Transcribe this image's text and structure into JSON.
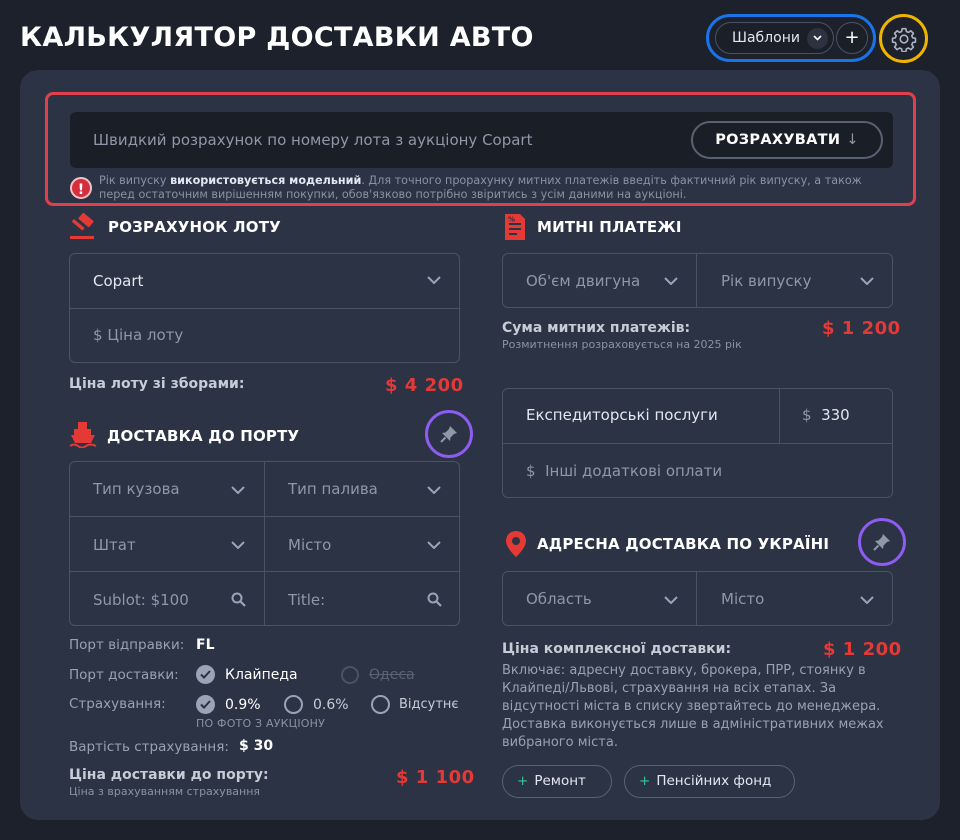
{
  "header": {
    "title": "КАЛЬКУЛЯТОР ДОСТАВКИ АВТО",
    "templates_label": "Шаблони",
    "add_label": "+"
  },
  "quick": {
    "placeholder": "Швидкий розрахунок по номеру лота з аукціону Copart",
    "button_label": "РОЗРАХУВАТИ",
    "button_arrow": "↓",
    "warning_prefix": "Рік випуску ",
    "warning_bold": "використовується модельний",
    "warning_line1_rest": ". Для точного прорахунку митних платежів введіть фактичний рік випуску, а також",
    "warning_line2": "перед остаточним вирішенням покупки, обов'язково потрібно звіритись з усім даними на аукціоні."
  },
  "lot": {
    "title": "РОЗРАХУНОК ЛОТУ",
    "auction_value": "Copart",
    "price_currency": "$",
    "price_placeholder": "Ціна лоту",
    "total_label": "Ціна лоту зі зборами:",
    "total_value": "$ 4 200"
  },
  "port": {
    "title": "ДОСТАВКА ДО ПОРТУ",
    "body_type": "Тип кузова",
    "fuel_type": "Тип палива",
    "state": "Штат",
    "city": "Місто",
    "sublot": "Sublot: $100",
    "title_field": "Title:",
    "departure_label": "Порт відправки:",
    "departure_value": "FL",
    "destination_label": "Порт доставки:",
    "destination_options": [
      "Клайпеда",
      "Одеса"
    ],
    "insurance_label": "Страхування:",
    "insurance_options": [
      "0.9%",
      "0.6%",
      "Відсутнє"
    ],
    "insurance_note": "ПО ФОТО З АУКЦІОНУ",
    "insurance_cost_label": "Вартість страхування:",
    "insurance_cost_value": "$ 30",
    "total_label": "Ціна доставки до порту:",
    "total_note": "Ціна з врахуванням страхування",
    "total_value": "$ 1 100"
  },
  "customs": {
    "title": "МИТНІ ПЛАТЕЖІ",
    "engine": "Об'єм двигуна",
    "year": "Рік випуску",
    "sum_label": "Сума митних платежів:",
    "sum_note": "Розмитнення розраховується на 2025 рік",
    "sum_value": "$ 1 200"
  },
  "services": {
    "forwarding_label": "Експедиторські послуги",
    "forwarding_currency": "$",
    "forwarding_value": "330",
    "other_currency": "$",
    "other_placeholder": "Інші додаткові оплати"
  },
  "address": {
    "title": "АДРЕСНА ДОСТАВКА ПО УКРАЇНІ",
    "region": "Область",
    "city": "Місто",
    "total_label": "Ціна комплексної доставки:",
    "total_value": "$ 1 200",
    "desc": [
      "Включає: адресну доставку, брокера, ПРР, стоянку в",
      "Клайпеді/Львові, страхування на всіх етапах. За",
      "відсутності міста в списку звертайтесь до менеджера.",
      "Доставка виконується лише в адміністративних межах",
      "вибраного міста."
    ],
    "addons": [
      "Ремонт",
      "Пенсійних фонд"
    ],
    "addon_plus": "+"
  },
  "colors": {
    "background": "#1c212b",
    "panel": "#2b3345",
    "accent_red": "#e53935",
    "ring_blue": "#1a73e8",
    "ring_yellow": "#f0b400",
    "ring_purple": "#8e5cf0"
  }
}
